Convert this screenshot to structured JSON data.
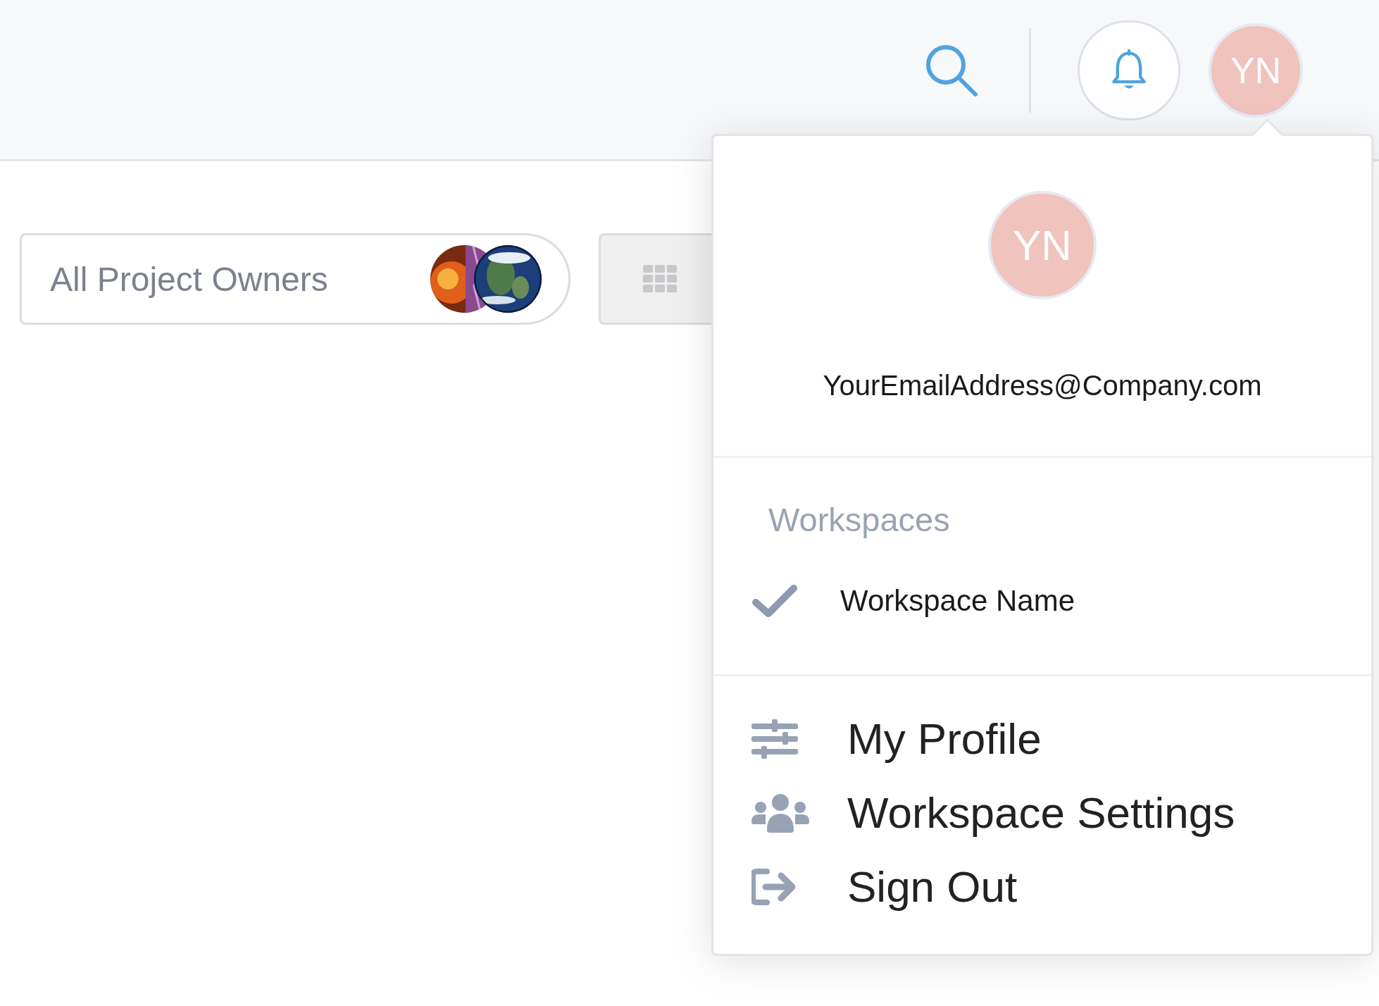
{
  "header": {
    "avatar_initials": "YN"
  },
  "filter": {
    "label": "All Project Owners"
  },
  "account_menu": {
    "avatar_initials": "YN",
    "email": "YourEmailAddress@Company.com",
    "workspaces_heading": "Workspaces",
    "workspaces": [
      {
        "name": "Workspace Name",
        "selected": true
      }
    ],
    "items": [
      {
        "kind": "profile",
        "label": "My Profile"
      },
      {
        "kind": "team",
        "label": "Workspace Settings"
      },
      {
        "kind": "signout",
        "label": "Sign Out"
      }
    ]
  }
}
